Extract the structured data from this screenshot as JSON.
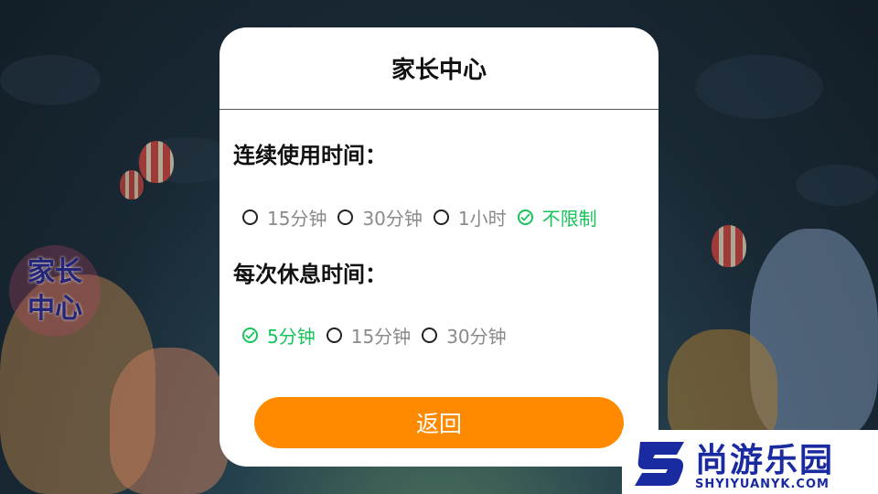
{
  "background": {
    "side_badge_line1": "家长",
    "side_badge_line2": "中心"
  },
  "dialog": {
    "title": "家长中心",
    "usage_section": {
      "label": "连续使用时间：",
      "options": [
        {
          "label": "15分钟",
          "selected": false
        },
        {
          "label": "30分钟",
          "selected": false
        },
        {
          "label": "1小时",
          "selected": false
        },
        {
          "label": "不限制",
          "selected": true
        }
      ]
    },
    "rest_section": {
      "label": "每次休息时间：",
      "options": [
        {
          "label": "5分钟",
          "selected": true
        },
        {
          "label": "15分钟",
          "selected": false
        },
        {
          "label": "30分钟",
          "selected": false
        }
      ]
    },
    "back_button": "返回"
  },
  "watermark": {
    "brand": "尚游乐园",
    "url": "SHYIYUANYK.COM"
  },
  "colors": {
    "accent_orange": "#ff8a00",
    "selected_green": "#17c45a",
    "unselected_gray": "#8a8a8a",
    "brand_blue": "#1a2aa0"
  }
}
